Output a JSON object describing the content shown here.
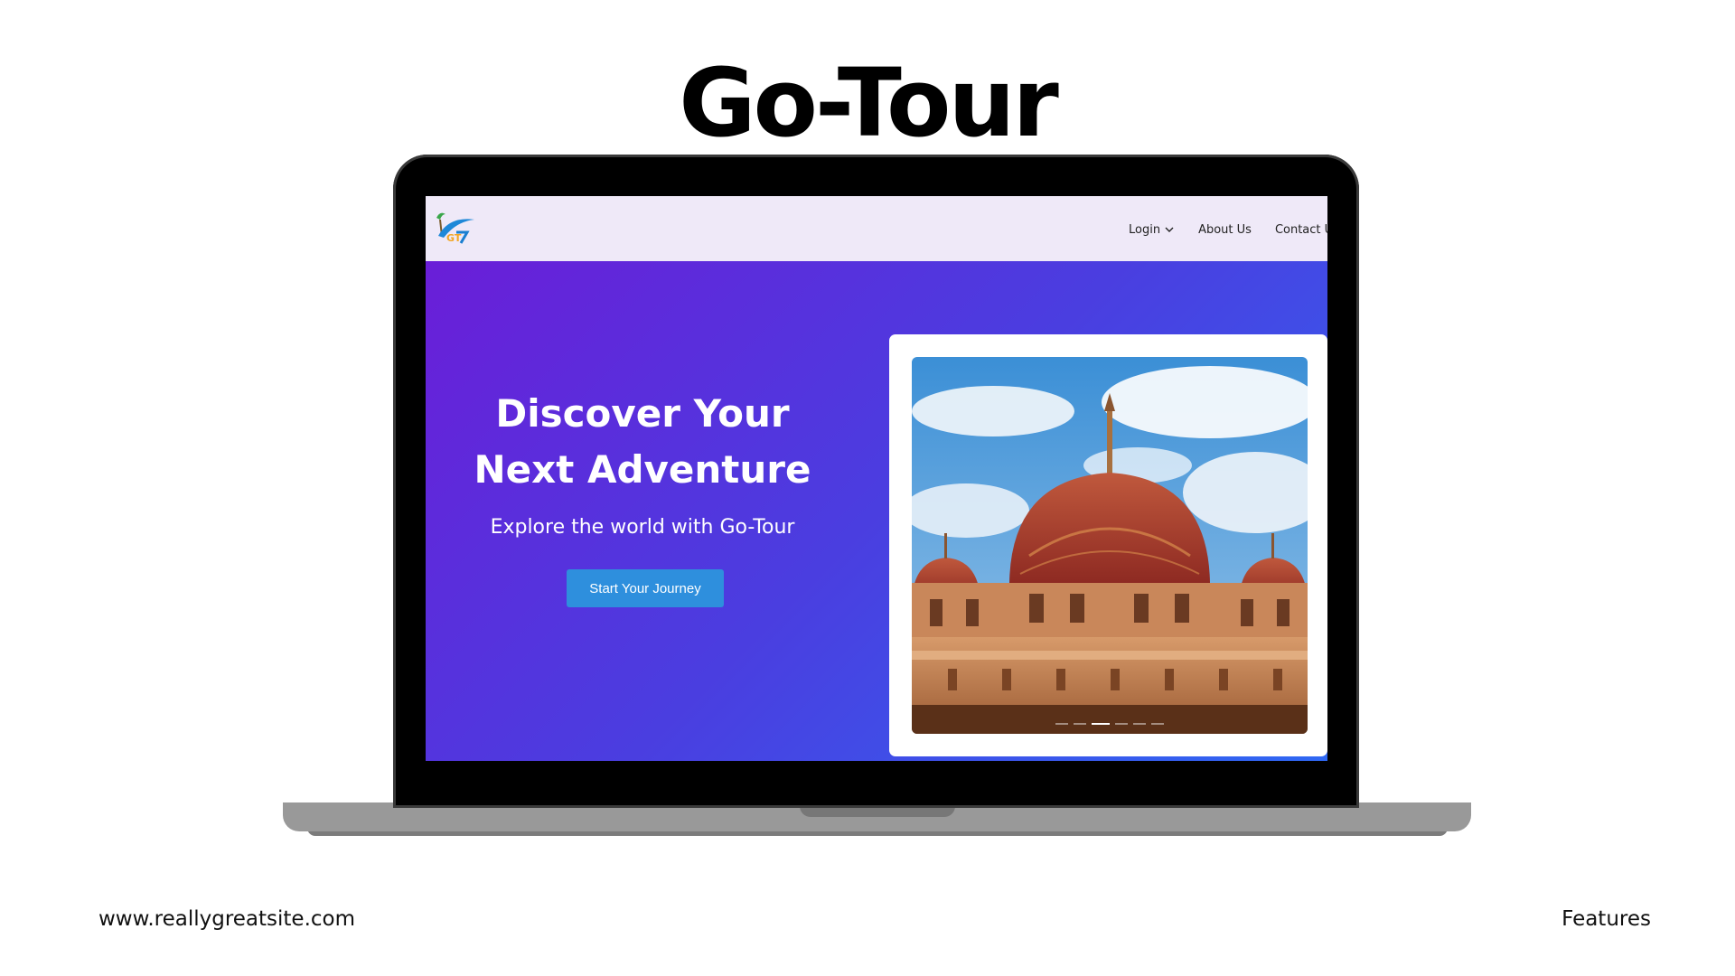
{
  "slide": {
    "title": "Go-Tour",
    "footer_url": "www.reallygreatsite.com",
    "footer_label": "Features"
  },
  "site": {
    "logo_text": "GT",
    "nav": {
      "login": "Login",
      "about": "About Us",
      "contact": "Contact Us"
    },
    "hero": {
      "title": "Discover Your Next Adventure",
      "subtitle": "Explore the world with Go-Tour",
      "cta": "Start Your Journey"
    },
    "carousel": {
      "slide_count": 6,
      "active_index": 2,
      "image_subject": "mosque-dome"
    }
  },
  "colors": {
    "hero_gradient_start": "#6a1ed8",
    "hero_gradient_end": "#2f68f3",
    "header_bg": "#efe9f8",
    "cta_bg": "#2e8fdd"
  }
}
